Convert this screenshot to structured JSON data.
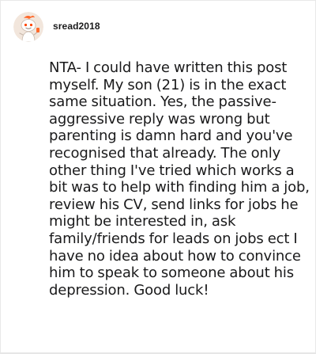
{
  "comment": {
    "username": "sread2018",
    "avatar_icon": "snoo-avatar-icon",
    "body": "NTA- I could have written this post myself. My son (21) is in the exact same situation. Yes, the passive- aggressive reply was wrong but parenting is damn hard and you've recognised that already. The only other thing I've tried which works a bit was to help with finding him a job, review his CV, send links for jobs he might be interested in, ask family/friends for leads on jobs ect I have no idea about how to convince him to speak to someone about his depression. Good luck!"
  },
  "colors": {
    "text": "#1a1a1b",
    "avatar_accent": "#ff6a2c",
    "avatar_bg": "#f2e6dc",
    "border": "#e8e8e8"
  }
}
